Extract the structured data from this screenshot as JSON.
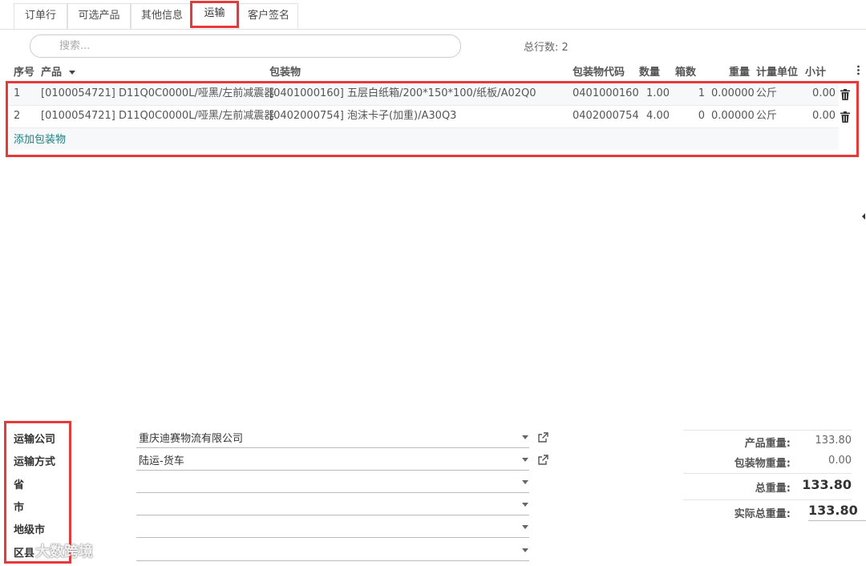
{
  "tabs": [
    {
      "label": "订单行"
    },
    {
      "label": "可选产品"
    },
    {
      "label": "其他信息"
    },
    {
      "label": "运输"
    },
    {
      "label": "客户签名"
    }
  ],
  "search": {
    "placeholder": "搜索..."
  },
  "row_count": "总行数: 2",
  "table": {
    "headers": {
      "seq": "序号",
      "product": "产品",
      "package": "包装物",
      "package_code": "包装物代码",
      "qty": "数量",
      "boxes": "箱数",
      "weight": "重量",
      "uom": "计量单位",
      "subtotal": "小计"
    },
    "rows": [
      {
        "seq": "1",
        "product": "[0100054721] D11Q0C0000L/哑黑/左前减震器",
        "package": "[0401000160] 五层白纸箱/200*150*100/纸板/A02Q0",
        "package_code": "0401000160",
        "qty": "1.00",
        "boxes": "1",
        "weight": "0.00000",
        "uom": "公斤",
        "subtotal": "0.00"
      },
      {
        "seq": "2",
        "product": "[0100054721] D11Q0C0000L/哑黑/左前减震器",
        "package": "[0402000754] 泡沫卡子(加重)/A30Q3",
        "package_code": "0402000754",
        "qty": "4.00",
        "boxes": "0",
        "weight": "0.00000",
        "uom": "公斤",
        "subtotal": "0.00"
      }
    ],
    "add_label": "添加包装物"
  },
  "form": {
    "company": {
      "label": "运输公司",
      "value": "重庆迪赛物流有限公司"
    },
    "method": {
      "label": "运输方式",
      "value": "陆运-货车"
    },
    "province": {
      "label": "省",
      "value": ""
    },
    "city": {
      "label": "市",
      "value": ""
    },
    "prefecture": {
      "label": "地级市",
      "value": ""
    },
    "county": {
      "label": "区县",
      "value": ""
    }
  },
  "totals": {
    "product_weight": {
      "label": "产品重量:",
      "value": "133.80"
    },
    "package_weight": {
      "label": "包装物重量:",
      "value": "0.00"
    },
    "total_weight": {
      "label": "总重量:",
      "value": "133.80"
    },
    "actual_weight": {
      "label": "实际总重量:",
      "value": "133.80"
    }
  },
  "watermark": "大数跨境",
  "colors": {
    "highlight": "#e63a3a",
    "link": "#1b7f82"
  }
}
